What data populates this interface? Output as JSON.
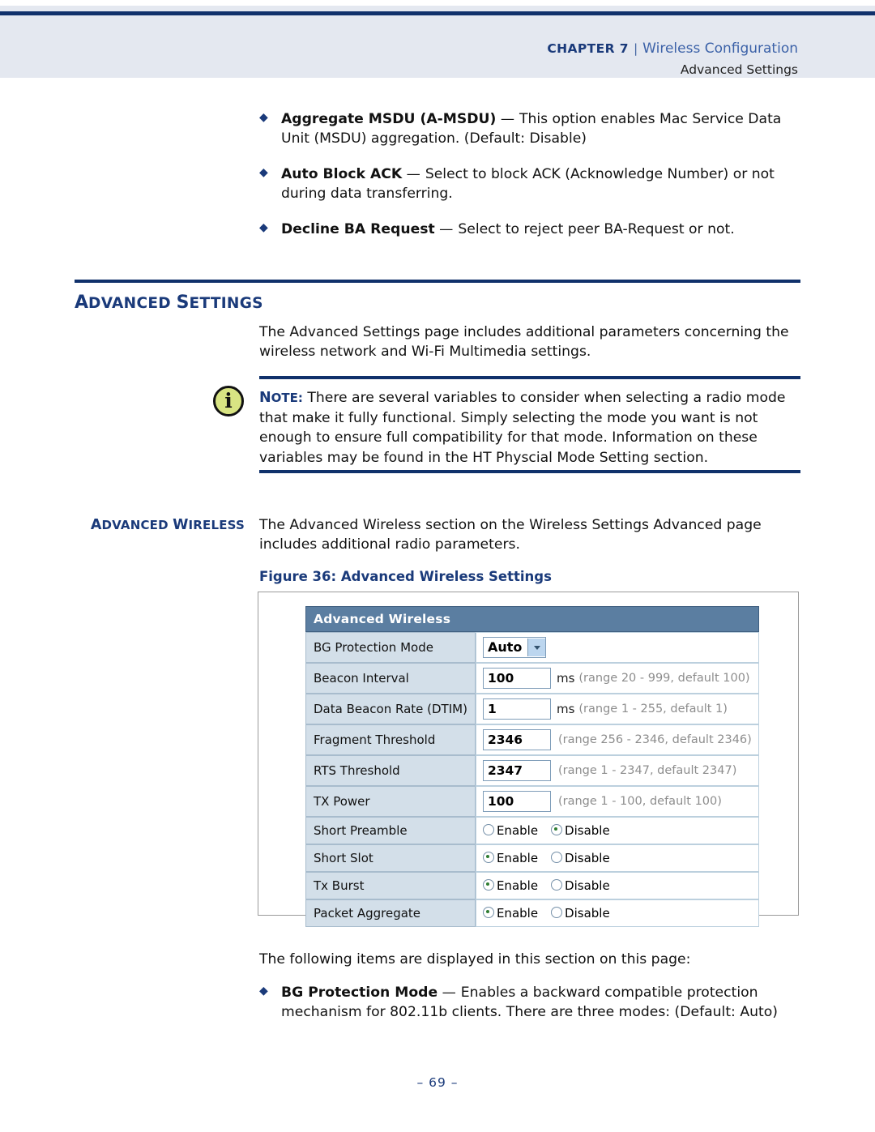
{
  "header": {
    "chapter_label": "CHAPTER 7",
    "separator": "|",
    "section": "Wireless Configuration",
    "subsection": "Advanced Settings"
  },
  "intro_bullets": [
    {
      "term": "Aggregate MSDU (A-MSDU)",
      "dash": "—",
      "description": "This option enables Mac Service Data Unit (MSDU) aggregation. (Default: Disable)"
    },
    {
      "term": "Auto Block ACK",
      "dash": "—",
      "description": "Select to block ACK (Acknowledge Number) or not during data transferring."
    },
    {
      "term": "Decline BA Request",
      "dash": "—",
      "description": "Select to reject peer BA-Request or not."
    }
  ],
  "section": {
    "title_first": "A",
    "title_first_rest": "DVANCED ",
    "title_second": "S",
    "title_second_rest": "ETTINGS",
    "paragraph": "The Advanced Settings page includes additional parameters concerning the wireless network and Wi-Fi Multimedia settings."
  },
  "note": {
    "icon": "info-icon",
    "label_cap": "N",
    "label_rest": "OTE:",
    "text": "There are several variables to consider when selecting a radio mode that make it fully functional. Simply selecting the mode you want is not enough to ensure full compatibility for that mode. Information on these variables may be found in the HT Physcial Mode Setting section."
  },
  "advanced_wireless": {
    "side_label_a": "A",
    "side_label_a_rest": "DVANCED ",
    "side_label_w": "W",
    "side_label_w_rest": "IRELESS",
    "paragraph": "The Advanced Wireless section on the Wireless Settings Advanced page includes additional radio parameters.",
    "figure_caption": "Figure 36:  Advanced Wireless Settings"
  },
  "screenshot": {
    "panel_title": "Advanced Wireless",
    "rows": [
      {
        "label": "BG Protection Mode",
        "control": "select",
        "value": "Auto",
        "unit": "",
        "hint": ""
      },
      {
        "label": "Beacon Interval",
        "control": "text",
        "value": "100",
        "unit": "ms",
        "hint": "(range 20 - 999, default 100)"
      },
      {
        "label": "Data Beacon Rate (DTIM)",
        "control": "text",
        "value": "1",
        "unit": "ms",
        "hint": "(range 1 - 255, default 1)"
      },
      {
        "label": "Fragment Threshold",
        "control": "text",
        "value": "2346",
        "unit": "",
        "hint": "(range 256 - 2346, default 2346)"
      },
      {
        "label": "RTS Threshold",
        "control": "text",
        "value": "2347",
        "unit": "",
        "hint": "(range 1 - 2347, default 2347)"
      },
      {
        "label": "TX Power",
        "control": "text",
        "value": "100",
        "unit": "",
        "hint": "(range 1 - 100, default 100)"
      },
      {
        "label": "Short Preamble",
        "control": "radio",
        "options": [
          "Enable",
          "Disable"
        ],
        "selected": "Disable"
      },
      {
        "label": "Short Slot",
        "control": "radio",
        "options": [
          "Enable",
          "Disable"
        ],
        "selected": "Enable"
      },
      {
        "label": "Tx Burst",
        "control": "radio",
        "options": [
          "Enable",
          "Disable"
        ],
        "selected": "Enable"
      },
      {
        "label": "Packet Aggregate",
        "control": "radio",
        "options": [
          "Enable",
          "Disable"
        ],
        "selected": "Enable"
      }
    ]
  },
  "closing": {
    "lead_in": "The following items are displayed in this section on this page:",
    "bullet": {
      "term": "BG Protection Mode",
      "dash": "—",
      "description": "Enables a backward compatible protection mechanism for 802.11b clients. There are three modes: (Default: Auto)"
    }
  },
  "footer": {
    "page_number": "–  69  –"
  }
}
